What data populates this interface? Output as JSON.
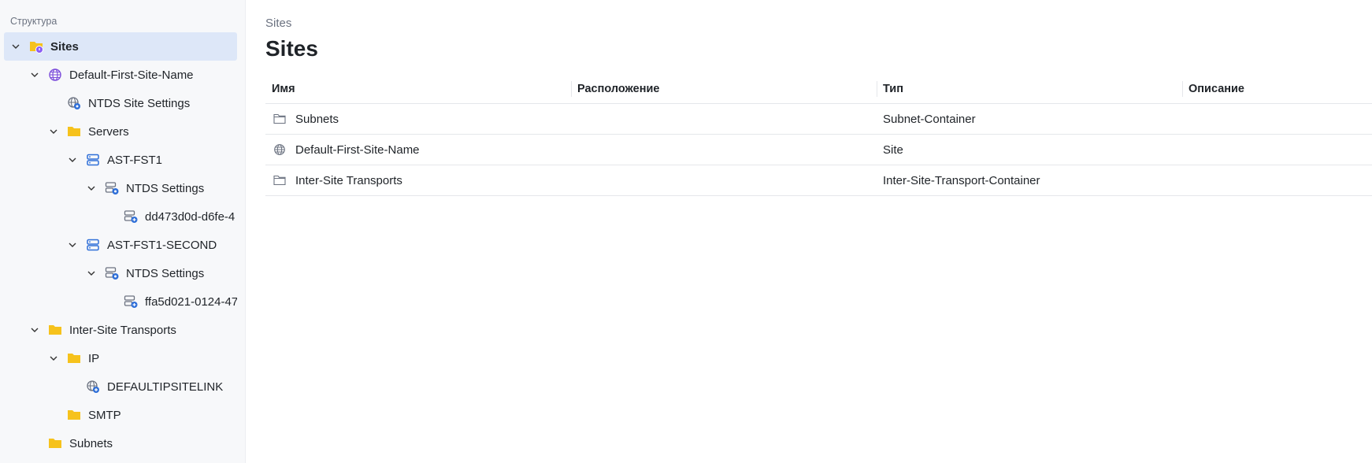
{
  "sidebar": {
    "title": "Структура",
    "items": [
      {
        "label": "Sites",
        "icon": "folder-sites-icon",
        "expanded": true,
        "selected": true
      },
      {
        "label": "Default-First-Site-Name",
        "icon": "globe-icon",
        "expanded": true
      },
      {
        "label": "NTDS Site Settings",
        "icon": "globe-settings-icon"
      },
      {
        "label": "Servers",
        "icon": "folder-icon",
        "expanded": true
      },
      {
        "label": "AST-FST1",
        "icon": "server-icon",
        "expanded": true
      },
      {
        "label": "NTDS Settings",
        "icon": "server-settings-icon",
        "expanded": true
      },
      {
        "label": "dd473d0d-d6fe-4",
        "icon": "server-link-icon"
      },
      {
        "label": "AST-FST1-SECOND",
        "icon": "server-icon",
        "expanded": true
      },
      {
        "label": "NTDS Settings",
        "icon": "server-settings-icon",
        "expanded": true
      },
      {
        "label": "ffa5d021-0124-47",
        "icon": "server-link-icon"
      },
      {
        "label": "Inter-Site Transports",
        "icon": "folder-icon",
        "expanded": true
      },
      {
        "label": "IP",
        "icon": "folder-icon",
        "expanded": true
      },
      {
        "label": "DEFAULTIPSITELINK",
        "icon": "globe-link-icon"
      },
      {
        "label": "SMTP",
        "icon": "folder-icon"
      },
      {
        "label": "Subnets",
        "icon": "folder-icon"
      }
    ]
  },
  "main": {
    "breadcrumb": "Sites",
    "title": "Sites",
    "columns": [
      "Имя",
      "Расположение",
      "Тип",
      "Описание"
    ],
    "rows": [
      {
        "name": "Subnets",
        "icon": "folder-outline-icon",
        "location": "",
        "type": "Subnet-Container",
        "description": ""
      },
      {
        "name": "Default-First-Site-Name",
        "icon": "globe-outline-icon",
        "location": "",
        "type": "Site",
        "description": ""
      },
      {
        "name": "Inter-Site Transports",
        "icon": "folder-outline-icon",
        "location": "",
        "type": "Inter-Site-Transport-Container",
        "description": ""
      }
    ]
  },
  "colors": {
    "folder": "#f6c21c",
    "globe": "#7c4ddb",
    "server": "#2f6fd8",
    "selected_bg": "#dde7f8",
    "sidebar_bg": "#f7f8fa"
  }
}
